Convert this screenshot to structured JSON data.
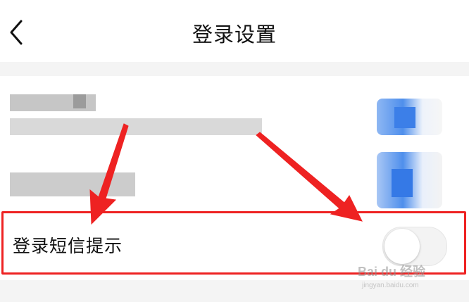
{
  "header": {
    "title": "登录设置",
    "back_icon": "chevron-left-icon"
  },
  "settings": {
    "redacted_rows": 2,
    "sms_alert": {
      "label": "登录短信提示",
      "enabled": false
    }
  },
  "annotation": {
    "color": "#ee2222"
  },
  "watermark": {
    "brand": "Bai du 经验",
    "sub": "jingyan.baidu.com"
  }
}
